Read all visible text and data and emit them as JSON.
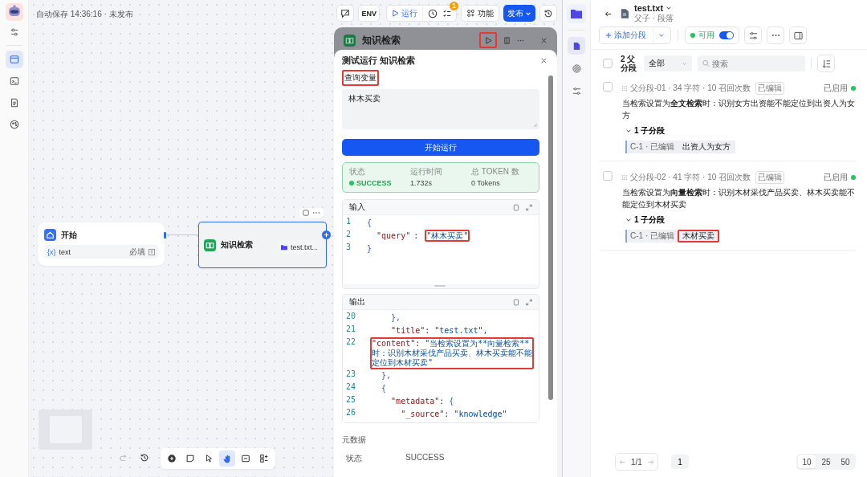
{
  "rail": [
    {
      "selected": true
    },
    {
      "selected": false
    },
    {
      "selected": false
    },
    {
      "selected": false
    }
  ],
  "canvas": {
    "autosave": "自动保存 14:36:16 · 未发布"
  },
  "toolbar": {
    "env": "ENV",
    "run": "运行",
    "badge": "1",
    "features": "功能",
    "publish": "发布"
  },
  "nodes": [
    {
      "kind": "start",
      "title": "开始",
      "param_icon": "{x}",
      "param": "text",
      "required": "必填",
      "selected": false
    },
    {
      "kind": "knowledge",
      "title": "知识检索",
      "file": "test.txt...",
      "selected": true
    }
  ],
  "node_panel": {
    "title": "知识检索",
    "run_highlighted": true
  },
  "test_run": {
    "title": "测试运行 知识检索",
    "variable_label": "查询变量",
    "label_highlighted": true,
    "value": "林木买卖",
    "run_button": "开始运行",
    "stats": [
      {
        "kind": "status",
        "label": "状态",
        "value": "SUCCESS"
      },
      {
        "kind": "plain",
        "label": "运行时间",
        "value": "1.732s"
      },
      {
        "kind": "plain",
        "label": "总 TOKEN 数",
        "value": "0 Tokens"
      }
    ],
    "input": {
      "title": "输入",
      "lines": [
        {
          "num": "1",
          "tokens": [
            {
              "kind": "brace",
              "s": "{",
              "highlighted": false
            }
          ]
        },
        {
          "num": "2",
          "tokens": [
            {
              "kind": "key",
              "s": "  \"query\"",
              "highlighted": false
            },
            {
              "kind": "punct",
              "s": ": ",
              "highlighted": false
            },
            {
              "kind": "str",
              "s": "\"林木买卖\"",
              "highlighted": true
            }
          ]
        },
        {
          "num": "3",
          "tokens": [
            {
              "kind": "brace",
              "s": "}",
              "highlighted": false
            }
          ]
        }
      ]
    },
    "output": {
      "title": "输出",
      "lines": [
        {
          "num": "20",
          "highlighted": false,
          "tokens": [
            {
              "kind": "brace",
              "s": "    },"
            }
          ]
        },
        {
          "num": "21",
          "highlighted": false,
          "tokens": [
            {
              "kind": "key",
              "s": "    \"title\""
            },
            {
              "kind": "punct",
              "s": ": "
            },
            {
              "kind": "str",
              "s": "\"test.txt\","
            }
          ]
        },
        {
          "num": "22",
          "highlighted": true,
          "tokens": [
            {
              "kind": "key",
              "s": "\"content\""
            },
            {
              "kind": "punct",
              "s": ": "
            },
            {
              "kind": "str",
              "s": "\"当检索设置为**向量检索**时：识别木材采伐产品买卖、林木买卖能不能定位到木材买卖\""
            }
          ]
        },
        {
          "num": "23",
          "highlighted": false,
          "tokens": [
            {
              "kind": "brace",
              "s": "  },"
            }
          ]
        },
        {
          "num": "24",
          "highlighted": false,
          "tokens": [
            {
              "kind": "brace",
              "s": "  {"
            }
          ]
        },
        {
          "num": "25",
          "highlighted": false,
          "tokens": [
            {
              "kind": "key",
              "s": "    \"metadata\""
            },
            {
              "kind": "punct",
              "s": ": "
            },
            {
              "kind": "brace",
              "s": "{"
            }
          ]
        },
        {
          "num": "26",
          "highlighted": false,
          "tokens": [
            {
              "kind": "key",
              "s": "      \"_source\""
            },
            {
              "kind": "punct",
              "s": ": "
            },
            {
              "kind": "str",
              "s": "\"knowledge\""
            }
          ]
        }
      ]
    },
    "metadata_title": "元数据",
    "metadata": [
      {
        "label": "状态",
        "value": "SUCCESS"
      }
    ]
  },
  "doc_nav": [
    {
      "selected": true
    },
    {
      "selected": false
    },
    {
      "selected": false
    }
  ],
  "doc": {
    "title": "test.txt",
    "subtitle": "父子 · 段落",
    "add_button": "添加分段",
    "status_label": "可用",
    "enabled": true,
    "all_checked": false,
    "count": "2 父分段",
    "filter": "全部",
    "search_placeholder": "搜索",
    "segments": [
      {
        "checked": false,
        "meta": "父分段-01 · 34 字符 · 10 召回次数",
        "tag": "已编辑",
        "status": "已启用",
        "enabled": true,
        "text": "当检索设置为**全文检索**时：识别女方出资能不能定位到出资人为女方",
        "children_label": "1 子分段",
        "expanded": true,
        "children": [
          {
            "label": "C-1 · 已编辑",
            "text": "出资人为女方",
            "highlighted": false
          }
        ]
      },
      {
        "checked": false,
        "meta": "父分段-02 · 41 字符 · 10 召回次数",
        "tag": "已编辑",
        "status": "已启用",
        "enabled": true,
        "text": "当检索设置为**向量检索**时：识别木材采伐产品买卖、林木买卖能不能定位到木材买卖",
        "children_label": "1 子分段",
        "expanded": true,
        "children": [
          {
            "label": "C-1 · 已编辑",
            "text": "木材买卖",
            "highlighted": true
          }
        ]
      }
    ],
    "pager": {
      "pages": "1/1",
      "current": "1",
      "sizes": [
        {
          "label": "10",
          "selected": true
        },
        {
          "label": "25",
          "selected": false
        },
        {
          "label": "50",
          "selected": false
        }
      ]
    }
  }
}
